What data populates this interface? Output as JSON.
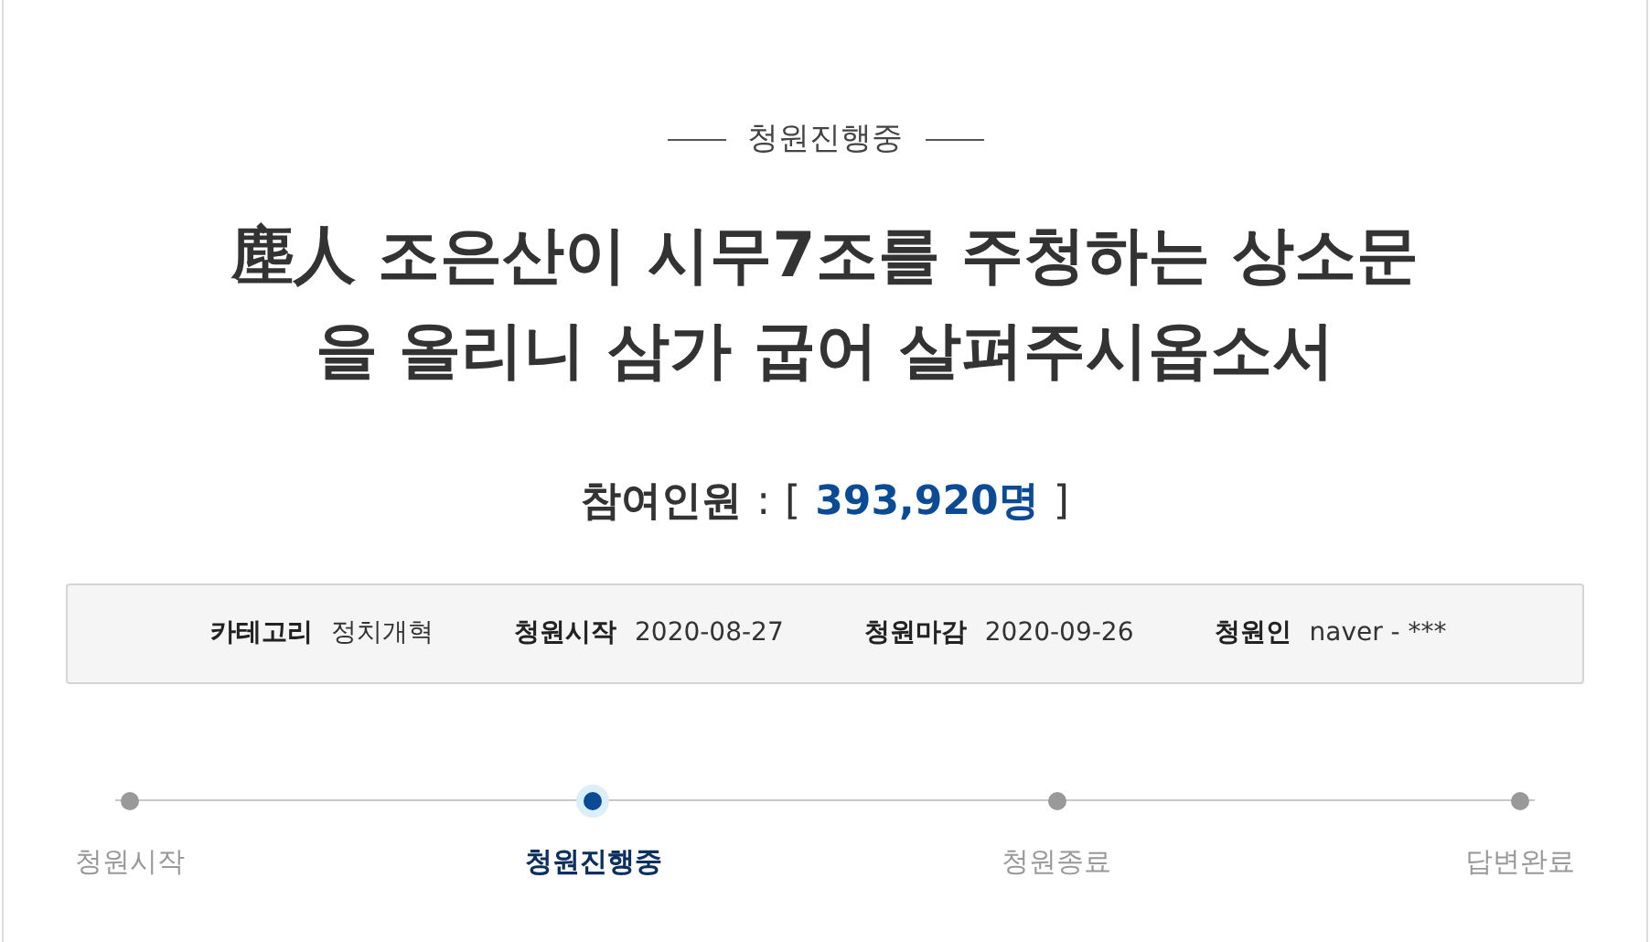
{
  "status_label": "청원진행중",
  "title": "塵人 조은산이 시무7조를 주청하는 상소문을 올리니 삼가 굽어 살펴주시옵소서",
  "participants": {
    "label": "참여인원",
    "separator": ":",
    "open": "[",
    "count": "393,920명",
    "close": "]"
  },
  "info": [
    {
      "label": "카테고리",
      "value": "정치개혁"
    },
    {
      "label": "청원시작",
      "value": "2020-08-27"
    },
    {
      "label": "청원마감",
      "value": "2020-09-26"
    },
    {
      "label": "청원인",
      "value": "naver - ***"
    }
  ],
  "steps": [
    {
      "label": "청원시작",
      "selected": false
    },
    {
      "label": "청원진행중",
      "selected": true
    },
    {
      "label": "청원종료",
      "selected": false
    },
    {
      "label": "답변완료",
      "selected": false
    }
  ]
}
